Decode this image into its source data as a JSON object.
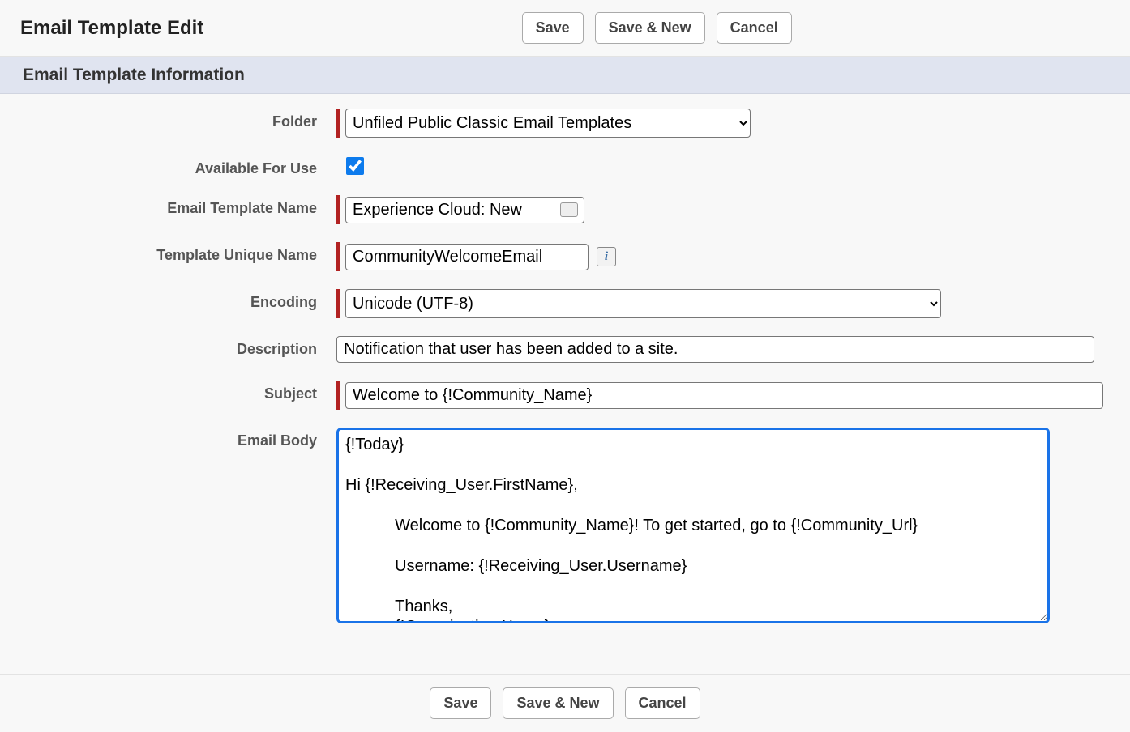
{
  "page": {
    "title": "Email Template Edit"
  },
  "buttons": {
    "save": "Save",
    "save_new": "Save & New",
    "cancel": "Cancel"
  },
  "section": {
    "info": "Email Template Information"
  },
  "labels": {
    "folder": "Folder",
    "available": "Available For Use",
    "tpl_name": "Email Template Name",
    "unique_name": "Template Unique Name",
    "encoding": "Encoding",
    "description": "Description",
    "subject": "Subject",
    "body": "Email Body"
  },
  "fields": {
    "folder_selected": "Unfiled Public Classic Email Templates",
    "available_checked": true,
    "template_name": "Experience Cloud: New",
    "unique_name": "CommunityWelcomeEmail",
    "encoding_selected": "Unicode (UTF-8)",
    "description": "Notification that user has been added to a site.",
    "subject": "Welcome to {!Community_Name}",
    "body": "{!Today}\n\nHi {!Receiving_User.FirstName},\n\n           Welcome to {!Community_Name}! To get started, go to {!Community_Url}\n\n           Username: {!Receiving_User.Username}\n\n           Thanks,\n           {!Organization.Name}"
  },
  "info_icon": "i"
}
